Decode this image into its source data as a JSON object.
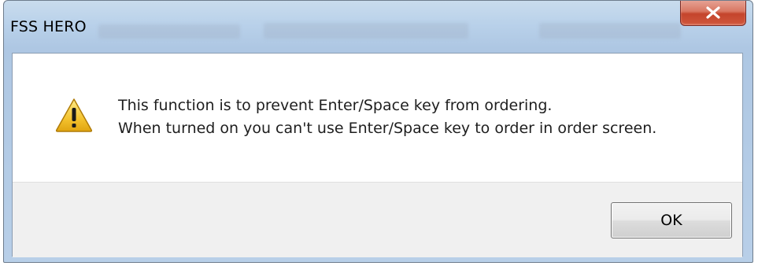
{
  "window": {
    "title": "FSS HERO"
  },
  "dialog": {
    "icon": "warning-icon",
    "message_line_1": "This function is to prevent Enter/Space key from ordering.",
    "message_line_2": "When turned on you can't use Enter/Space key to order in order screen.",
    "ok_label": "OK"
  },
  "colors": {
    "close_button": "#c74a30",
    "warning_fill": "#f4c430",
    "footer_bg": "#f0f0f0"
  }
}
